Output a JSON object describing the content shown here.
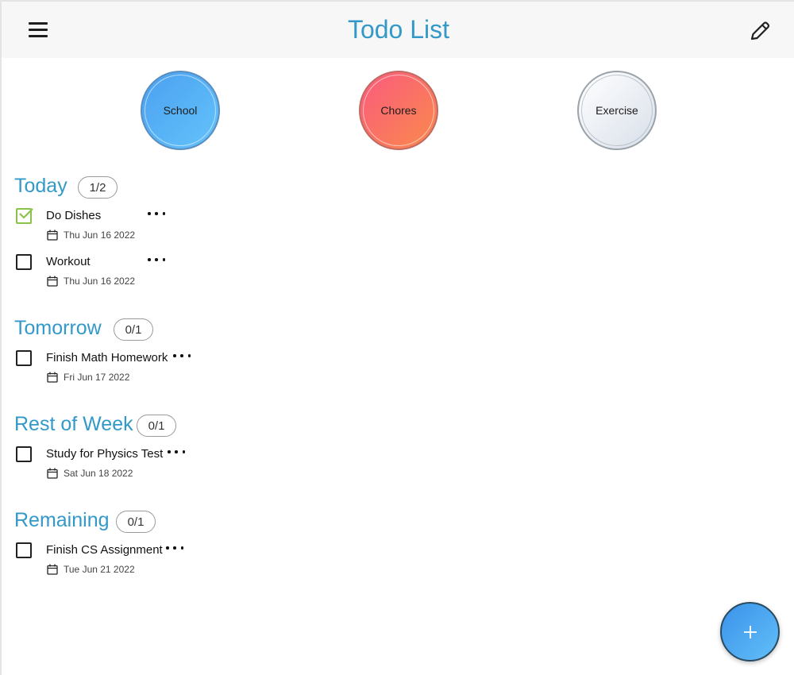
{
  "app": {
    "title": "Todo List"
  },
  "header": {
    "menu_icon": "menu-icon",
    "edit_icon": "pencil-icon"
  },
  "categories": [
    {
      "label": "School",
      "color_start": "#4aa0f0",
      "color_end": "#64c3fb"
    },
    {
      "label": "Chores",
      "color_start": "#fb5a7e",
      "color_end": "#f98a4c"
    },
    {
      "label": "Exercise",
      "color_start": "#ffffff",
      "color_end": "#d9e0ea"
    }
  ],
  "sections": [
    {
      "title": "Today",
      "badge": "1/2",
      "tasks": [
        {
          "name": "Do Dishes",
          "date": "Thu Jun 16 2022",
          "done": true
        },
        {
          "name": "Workout",
          "date": "Thu Jun 16 2022",
          "done": false
        }
      ]
    },
    {
      "title": "Tomorrow",
      "badge": "0/1",
      "tasks": [
        {
          "name": "Finish Math Homework",
          "date": "Fri Jun 17 2022",
          "done": false
        }
      ]
    },
    {
      "title": "Rest of Week",
      "badge": "0/1",
      "tasks": [
        {
          "name": "Study for Physics Test",
          "date": "Sat Jun 18 2022",
          "done": false
        }
      ]
    },
    {
      "title": "Remaining",
      "badge": "0/1",
      "tasks": [
        {
          "name": "Finish CS Assignment",
          "date": "Tue Jun 21 2022",
          "done": false
        }
      ]
    }
  ],
  "colors": {
    "accent": "#3399c8",
    "check": "#8bc34a",
    "fab": "#3b92ea"
  },
  "fab": {
    "icon": "plus-icon"
  }
}
